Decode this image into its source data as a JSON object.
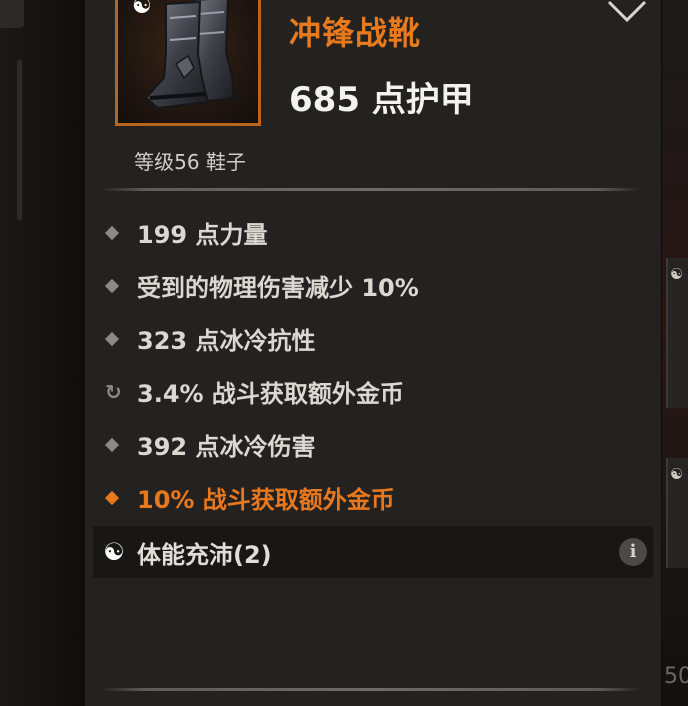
{
  "item": {
    "name": "冲锋战靴",
    "armor": "685 点护甲",
    "type_line": "等级56 鞋子",
    "icon": "boots-icon",
    "rarity_color": "#e87a1e"
  },
  "stats": [
    {
      "text": "199 点力量",
      "bullet": "diamond"
    },
    {
      "text": "受到的物理伤害减少 10%",
      "bullet": "diamond"
    },
    {
      "text": "323 点冰冷抗性",
      "bullet": "diamond"
    },
    {
      "text": "3.4% 战斗获取额外金币",
      "bullet": "reroll"
    },
    {
      "text": "392 点冰冷伤害",
      "bullet": "diamond"
    },
    {
      "text": "10% 战斗获取额外金币",
      "bullet": "legendary-diamond"
    }
  ],
  "set": {
    "name": "体能充沛(2)",
    "icon": "yin-yang-icon",
    "info_icon": "info-icon"
  },
  "background": {
    "right_number": "50"
  }
}
